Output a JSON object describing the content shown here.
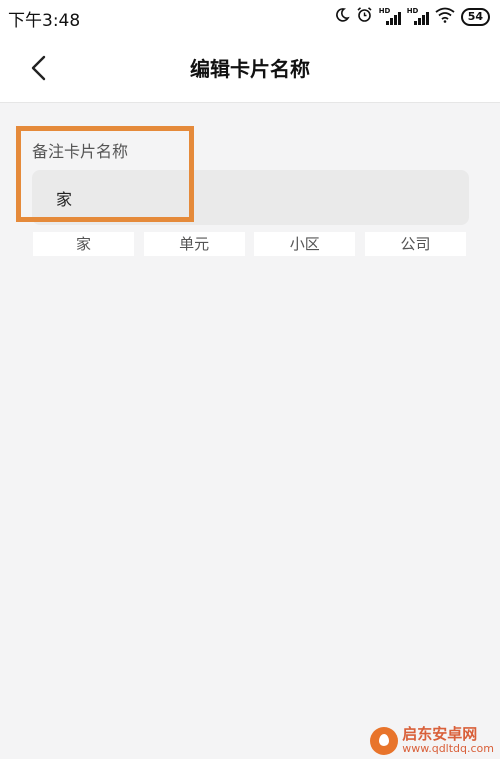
{
  "status_bar": {
    "time": "下午3:48",
    "hd_label": "HD",
    "battery": "54",
    "icons": [
      "moon-icon",
      "alarm-icon",
      "signal-hd-icon",
      "signal-hd-icon",
      "wifi-icon",
      "battery-icon"
    ]
  },
  "header": {
    "title": "编辑卡片名称",
    "back_icon": "chevron-left-icon"
  },
  "form": {
    "label": "备注卡片名称",
    "value": "家"
  },
  "suggestions": [
    "家",
    "单元",
    "小区",
    "公司"
  ],
  "annotation": {
    "highlight_color": "#e58a3a"
  },
  "watermark": {
    "title": "启东安卓网",
    "url": "www.qdltdq.com"
  }
}
